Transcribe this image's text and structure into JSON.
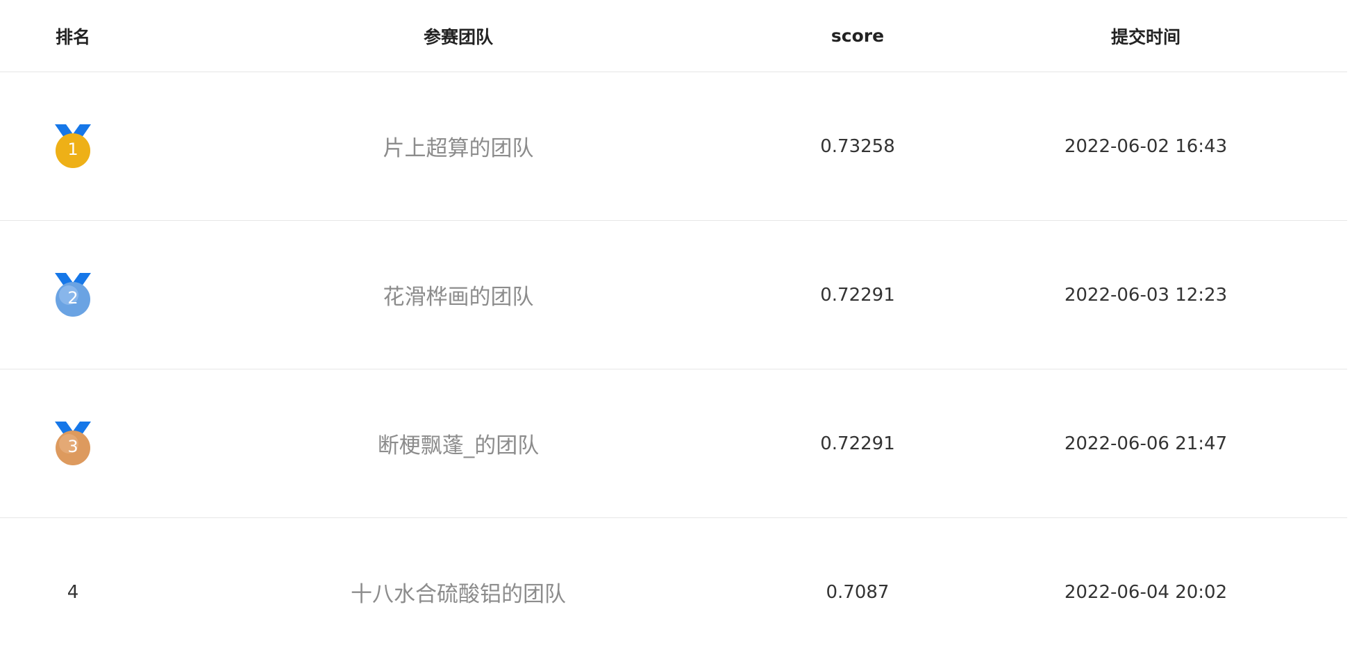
{
  "header": {
    "rank": "排名",
    "team": "参赛团队",
    "score": "score",
    "time": "提交时间"
  },
  "rows": [
    {
      "rank": "1",
      "medal": "gold-medal-icon",
      "team": "片上超算的团队",
      "score": "0.73258",
      "time": "2022-06-02 16:43"
    },
    {
      "rank": "2",
      "medal": "silver-medal-icon",
      "team": "花滑桦画的团队",
      "score": "0.72291",
      "time": "2022-06-03 12:23"
    },
    {
      "rank": "3",
      "medal": "bronze-medal-icon",
      "team": "断梗飘蓬_的团队",
      "score": "0.72291",
      "time": "2022-06-06 21:47"
    },
    {
      "rank": "4",
      "medal": "",
      "team": "十八水合硫酸铝的团队",
      "score": "0.7087",
      "time": "2022-06-04 20:02"
    }
  ],
  "colors": {
    "ribbon": "#1677e8",
    "gold": "#f2b51c",
    "silver": "#6aa3e3",
    "bronze": "#dd9a5e",
    "team_text": "#8c8c8c",
    "divider": "#e6e6e6"
  }
}
